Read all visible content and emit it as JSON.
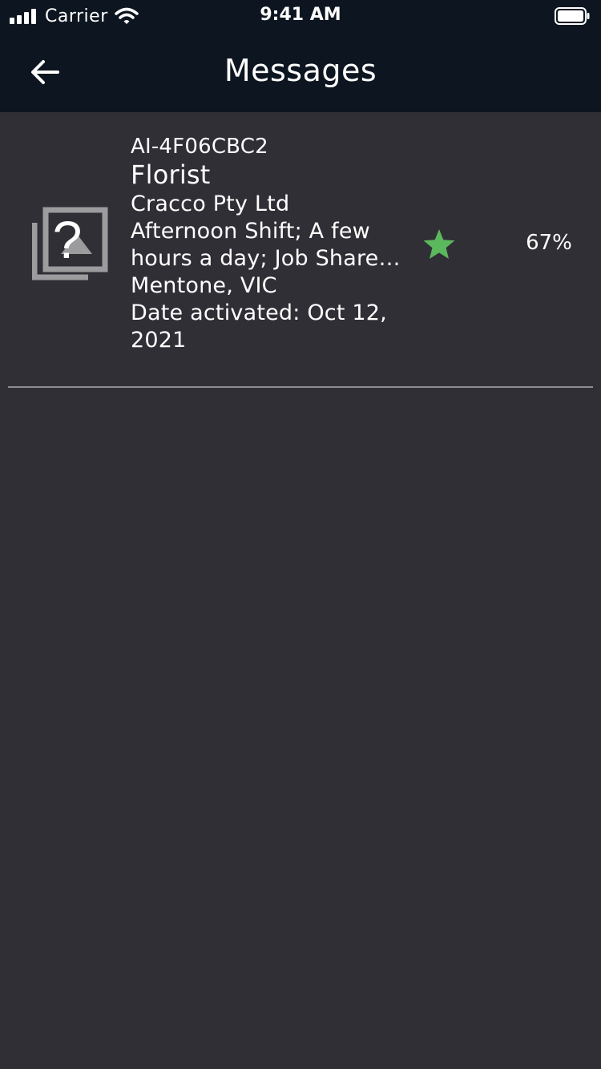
{
  "status_bar": {
    "carrier": "Carrier",
    "time": "9:41 AM",
    "icons": [
      "signal-icon",
      "wifi-icon",
      "battery-icon"
    ]
  },
  "nav": {
    "title": "Messages",
    "back_icon": "arrow-left-icon"
  },
  "messages": [
    {
      "thumbnail_icon": "missing-image-icon",
      "job_id": "AI-4F06CBC2",
      "title": "Florist",
      "company": "Cracco Pty Ltd",
      "shift": "Afternoon Shift; A few hours a day; Job Share; Part time",
      "location": "Mentone, VIC",
      "date_activated": "Date activated:  Oct 12, 2021",
      "favorite_icon": "star-icon",
      "match": "67%"
    }
  ],
  "colors": {
    "background": "#302f35",
    "header": "#0d1620",
    "star": "#5cb85c",
    "divider": "#8e8d92",
    "text": "#ffffff"
  }
}
